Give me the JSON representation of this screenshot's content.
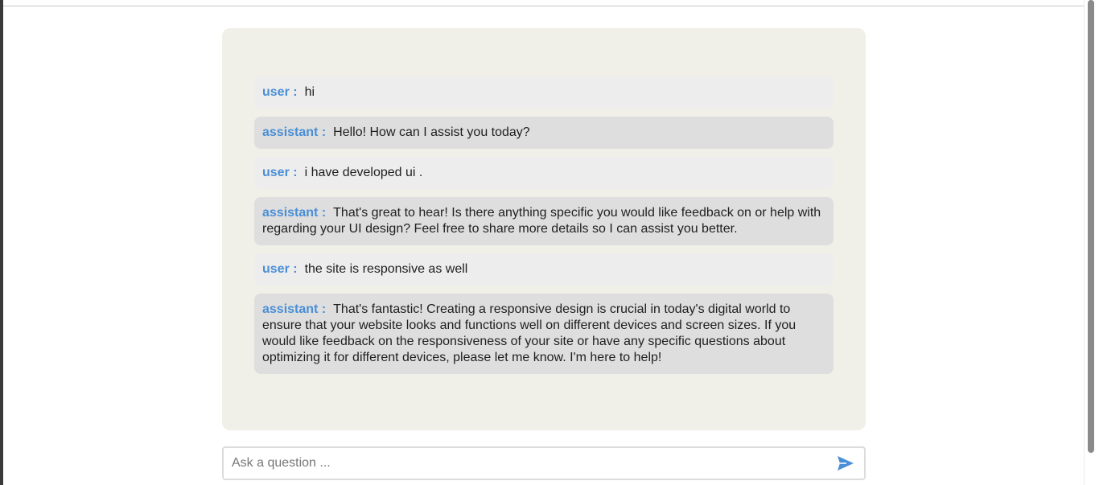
{
  "messages": [
    {
      "role": "user",
      "role_label": "user :",
      "text": "hi"
    },
    {
      "role": "assistant",
      "role_label": "assistant :",
      "text": "Hello! How can I assist you today?"
    },
    {
      "role": "user",
      "role_label": "user :",
      "text": "i have developed ui ."
    },
    {
      "role": "assistant",
      "role_label": "assistant :",
      "text": "That's great to hear! Is there anything specific you would like feedback on or help with regarding your UI design? Feel free to share more details so I can assist you better."
    },
    {
      "role": "user",
      "role_label": "user :",
      "text": "the site is responsive as well"
    },
    {
      "role": "assistant",
      "role_label": "assistant :",
      "text": "That's fantastic! Creating a responsive design is crucial in today's digital world to ensure that your website looks and functions well on different devices and screen sizes. If you would like feedback on the responsiveness of your site or have any specific questions about optimizing it for different devices, please let me know. I'm here to help!"
    }
  ],
  "input": {
    "placeholder": "Ask a question ...",
    "value": ""
  },
  "icons": {
    "send": "send-icon"
  },
  "colors": {
    "role_label": "#4a8fd6",
    "panel_background": "#f0f0e8",
    "user_bubble": "#ededed",
    "assistant_bubble": "#dedede",
    "send_icon": "#4a8fd6"
  }
}
